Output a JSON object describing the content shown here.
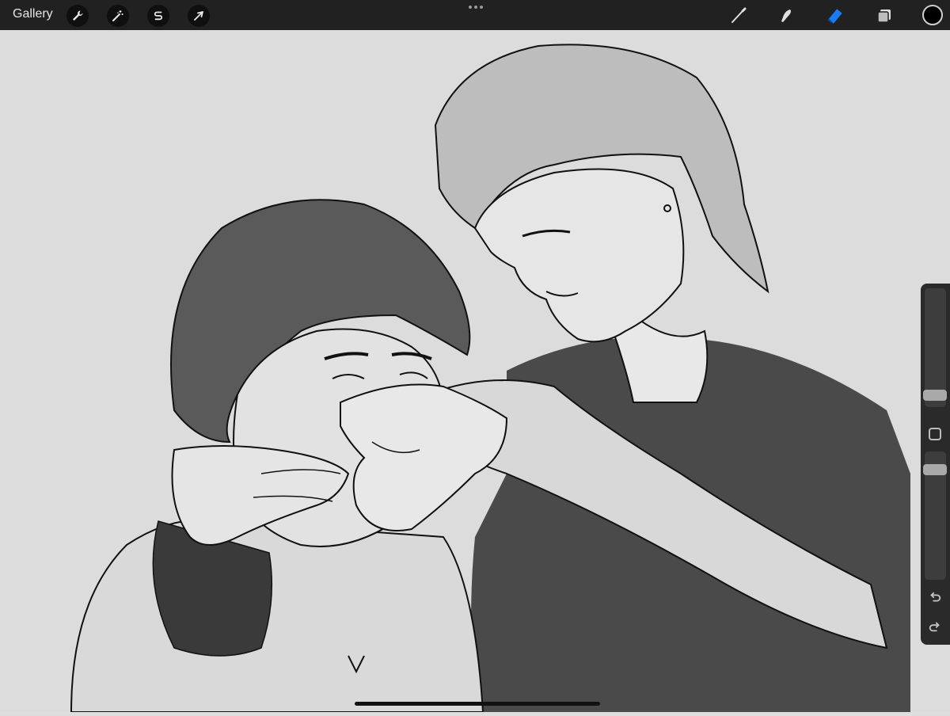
{
  "topbar": {
    "gallery_label": "Gallery",
    "left_tools": [
      "wrench-icon",
      "magic-wand-icon",
      "selection-s-icon",
      "transform-arrow-icon"
    ],
    "right_tools": [
      "brush-icon",
      "smudge-icon",
      "eraser-icon",
      "layers-icon"
    ],
    "active_tool": "eraser-icon",
    "active_color": "#000000",
    "accent_color": "#1a7cf5"
  },
  "sidebar": {
    "brush_size_level": 0.72,
    "opacity_level": 0.3,
    "icons": [
      "modify-square-icon",
      "undo-icon",
      "redo-icon"
    ]
  }
}
